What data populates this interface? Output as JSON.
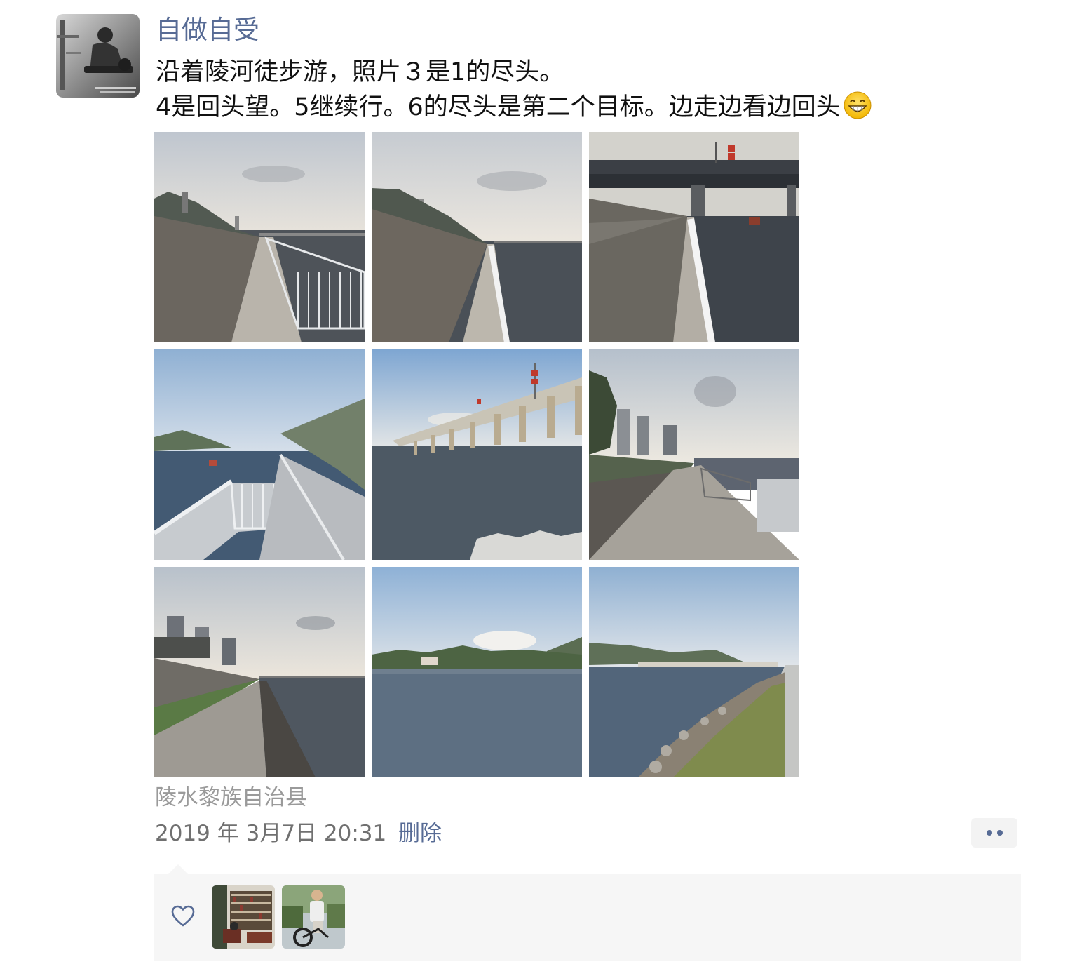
{
  "post": {
    "author": "自做自受",
    "text_line1": "沿着陵河徒步游，照片３是1的尽头。",
    "text_line2": "4是回头望。5继续行。6的尽头是第二个目标。边走边看边回头",
    "emoji": "grinning-face-icon",
    "photos": [
      {
        "label": "photo-1",
        "scene": "walkway-railing-river"
      },
      {
        "label": "photo-2",
        "scene": "walkway-river-distant-bridge"
      },
      {
        "label": "photo-3",
        "scene": "bridge-end-walkway"
      },
      {
        "label": "photo-4",
        "scene": "look-back-railing-hill"
      },
      {
        "label": "photo-5",
        "scene": "long-bridge-over-river"
      },
      {
        "label": "photo-6",
        "scene": "walkway-towers-sky"
      },
      {
        "label": "photo-7",
        "scene": "embankment-towers"
      },
      {
        "label": "photo-8",
        "scene": "river-shore-trees"
      },
      {
        "label": "photo-9",
        "scene": "river-bridge-rock-shore"
      }
    ],
    "location": "陵水黎族自治县",
    "timestamp": "2019 年 3月7日 20:31",
    "delete_label": "删除",
    "more_icon": "more-dots-icon"
  },
  "likes": {
    "heart_icon": "heart-outline-icon",
    "likers": [
      "liker-library",
      "liker-cyclist"
    ]
  },
  "colors": {
    "link": "#576b95",
    "text": "#111111",
    "meta": "#9a9a9a",
    "panel": "#f6f6f6"
  }
}
